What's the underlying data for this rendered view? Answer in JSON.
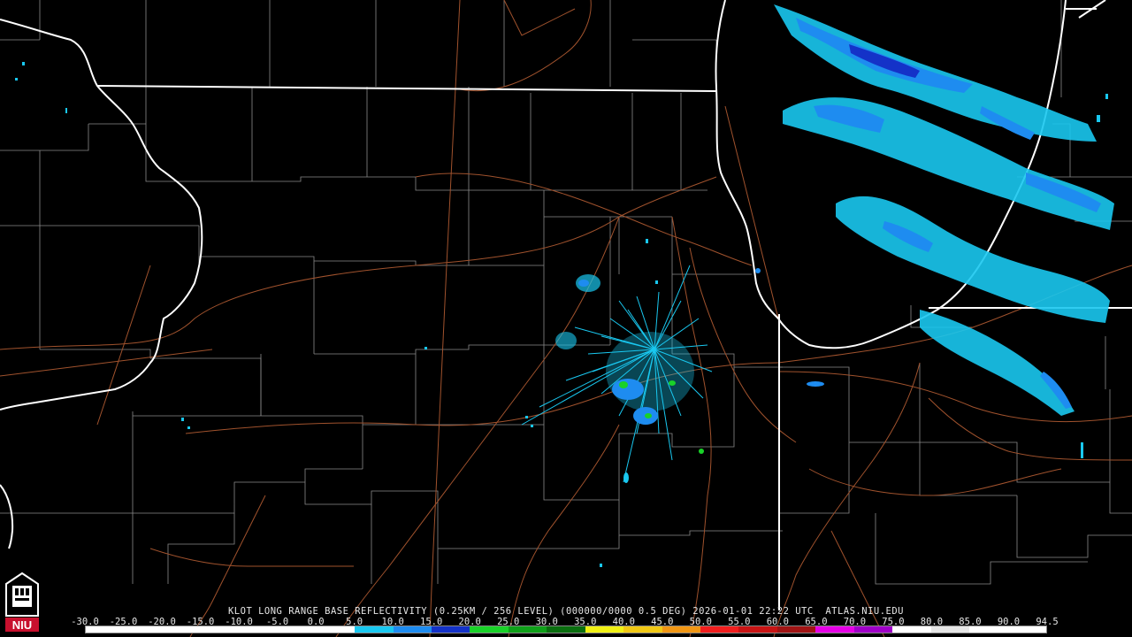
{
  "product": {
    "title": "KLOT LONG RANGE BASE REFLECTIVITY (0.25KM / 256 LEVEL) (000000/0000 0.5 DEG) 2026-01-01 22:22 UTC  ATLAS.NIU.EDU"
  },
  "scale": {
    "labels": [
      "-30.0",
      "-25.0",
      "-20.0",
      "-15.0",
      "-10.0",
      "-5.0",
      "0.0",
      "5.0",
      "10.0",
      "15.0",
      "20.0",
      "25.0",
      "30.0",
      "35.0",
      "40.0",
      "45.0",
      "50.0",
      "55.0",
      "60.0",
      "65.0",
      "70.0",
      "75.0",
      "80.0",
      "85.0",
      "90.0",
      "94.5"
    ],
    "colors": [
      "#ffffff",
      "#ffffff",
      "#ffffff",
      "#ffffff",
      "#ffffff",
      "#ffffff",
      "#ffffff",
      "#19c8f0",
      "#1e8cf0",
      "#1432c8",
      "#19d228",
      "#0fa019",
      "#0a6e0f",
      "#f0f014",
      "#f0c814",
      "#f09614",
      "#f01e1e",
      "#c81414",
      "#a01414",
      "#e600e6",
      "#a000c8",
      "#ffffff",
      "#e6e6e6",
      "#ffffff",
      "#ffffff"
    ]
  },
  "logo": {
    "text": "NIU",
    "color": "#c8102e"
  },
  "map": {
    "state_line_color": "#ffffff",
    "county_line_color": "#8a8a8a",
    "highway_color": "#a0522d",
    "radar_site": "KLOT",
    "echo_colors": {
      "light": "#19c8f0",
      "medium": "#1e8cf0",
      "heavy": "#1432c8",
      "green": "#19d228"
    }
  }
}
